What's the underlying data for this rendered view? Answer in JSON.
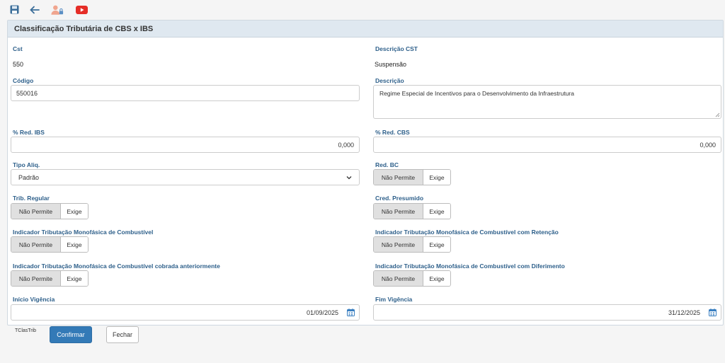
{
  "panel": {
    "title": "Classificação Tributária de CBS x IBS"
  },
  "cst": {
    "label": "Cst",
    "value": "550"
  },
  "descricao_cst": {
    "label": "Descrição CST",
    "value": "Suspensão"
  },
  "codigo": {
    "label": "Código",
    "value": "550016"
  },
  "descricao": {
    "label": "Descrição",
    "value": "Regime Especial de Incentivos para o Desenvolvimento da Infraestrutura"
  },
  "red_ibs": {
    "label": "% Red. IBS",
    "value": "0,000"
  },
  "red_cbs": {
    "label": "% Red. CBS",
    "value": "0,000"
  },
  "tipo_aliq": {
    "label": "Tipo Aliq.",
    "value": "Padrão"
  },
  "red_bc": {
    "label": "Red. BC",
    "opt_a": "Não Permite",
    "opt_b": "Exige"
  },
  "trib_regular": {
    "label": "Trib. Regular",
    "opt_a": "Não Permite",
    "opt_b": "Exige"
  },
  "cred_presumido": {
    "label": "Cred. Presumido",
    "opt_a": "Não Permite",
    "opt_b": "Exige"
  },
  "mono_comb": {
    "label": "Indicador Tributação Monofásica de Combustível",
    "opt_a": "Não Permite",
    "opt_b": "Exige"
  },
  "mono_comb_ret": {
    "label": "Indicador Tributação Monofásica de Combustível com Retenção",
    "opt_a": "Não Permite",
    "opt_b": "Exige"
  },
  "mono_comb_ant": {
    "label": "Indicador Tributação Monofásica de Combustível cobrada anteriormente",
    "opt_a": "Não Permite",
    "opt_b": "Exige"
  },
  "mono_comb_dif": {
    "label": "Indicador Tributação Monofásica de Combustível com Diferimento",
    "opt_a": "Não Permite",
    "opt_b": "Exige"
  },
  "inicio_vigencia": {
    "label": "Início Vigência",
    "value": "01/09/2025"
  },
  "fim_vigencia": {
    "label": "Fim Vigência",
    "value": "31/12/2025"
  },
  "footer": {
    "form_id": "TClasTrib",
    "confirm": "Confirmar",
    "close": "Fechar"
  },
  "colors": {
    "accent": "#337ab7",
    "label": "#2d5f8a",
    "header_bg": "#dfe8f0",
    "youtube": "#e52d27",
    "user_icon": "#f0a58e"
  },
  "icons": [
    "save-icon",
    "back-arrow-icon",
    "user-lock-icon",
    "youtube-icon",
    "calendar-icon"
  ]
}
